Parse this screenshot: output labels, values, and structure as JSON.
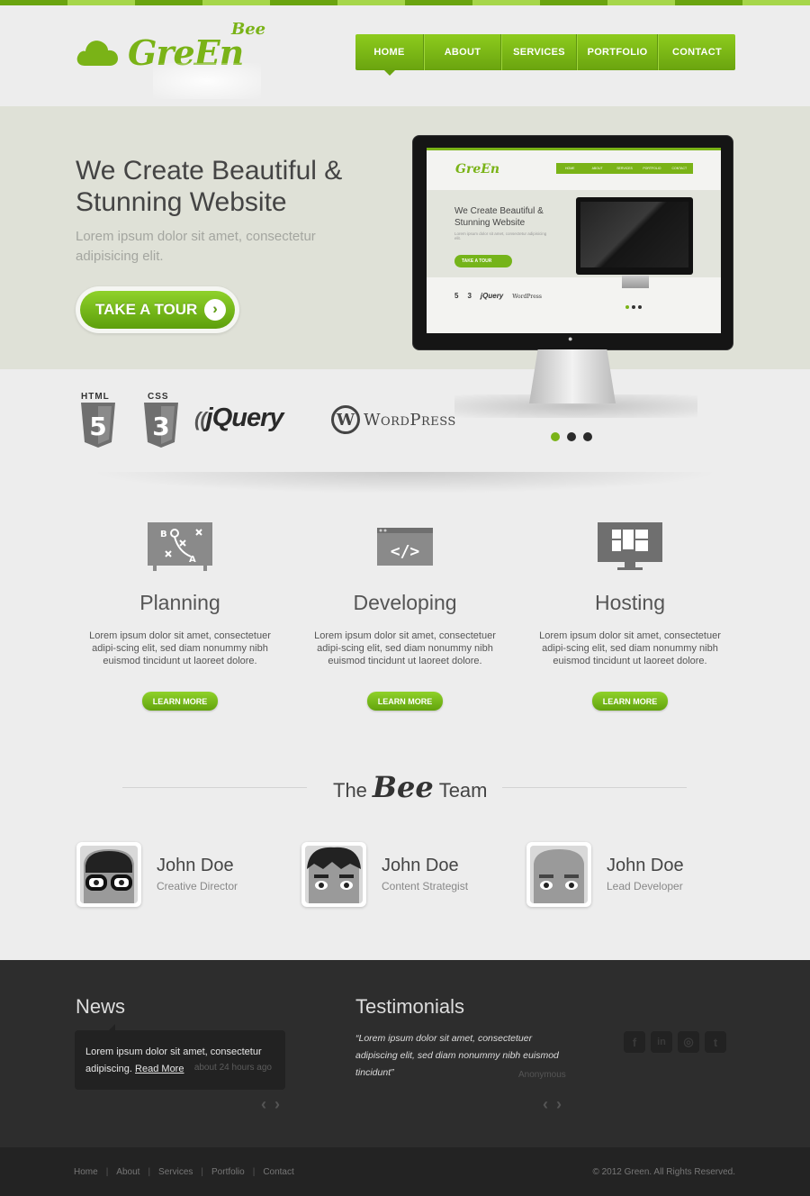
{
  "colors": {
    "accent": "#7ab317",
    "dark": "#2d2d2d"
  },
  "logo": {
    "line1": "Bee",
    "line2": "GreEn"
  },
  "nav": {
    "items": [
      "HOME",
      "ABOUT",
      "SERVICES",
      "PORTFOLIO",
      "CONTACT"
    ],
    "active": "HOME"
  },
  "hero": {
    "title": "We Create Beautiful & Stunning Website",
    "subtitle": "Lorem ipsum dolor sit amet, consectetur adipisicing elit.",
    "button": "TAKE A TOUR",
    "button_icon": "chevron-right-icon"
  },
  "preview": {
    "logo": "GreEn",
    "nav": [
      "HOME",
      "ABOUT",
      "SERVICES",
      "PORTFOLIO",
      "CONTACT"
    ],
    "title": "We Create Beautiful & Stunning Website",
    "subtitle": "Lorem ipsum dolor sit amet, consectetur adipisicing elit.",
    "button": "TAKE A TOUR",
    "logos": [
      "5",
      "3",
      "jQuery",
      "WordPress"
    ]
  },
  "tech_logos": {
    "html": "HTML",
    "html_digit": "5",
    "css": "CSS",
    "css_digit": "3",
    "jquery": "jQuery",
    "wordpress": "WordPress",
    "wp_mark": "W"
  },
  "slider": {
    "count": 3,
    "active": 1
  },
  "services": [
    {
      "name": "Planning",
      "icon": "strategy-board-icon",
      "desc": "Lorem ipsum dolor sit amet, consectetuer adipi-scing elit, sed diam nonummy nibh euismod tincidunt ut laoreet dolore.",
      "button": "LEARN MORE"
    },
    {
      "name": "Developing",
      "icon": "code-window-icon",
      "desc": "Lorem ipsum dolor sit amet, consectetuer adipi-scing elit, sed diam nonummy nibh euismod tincidunt ut laoreet dolore.",
      "button": "LEARN MORE"
    },
    {
      "name": "Hosting",
      "icon": "monitor-layout-icon",
      "desc": "Lorem ipsum dolor sit amet, consectetuer adipi-scing elit, sed diam nonummy nibh euismod tincidunt ut laoreet dolore.",
      "button": "LEARN MORE"
    }
  ],
  "team": {
    "title_pre": "The",
    "title_bee": "Bee",
    "title_post": "Team",
    "members": [
      {
        "name": "John Doe",
        "role": "Creative Director",
        "avatar": "glasses-avatar-icon"
      },
      {
        "name": "John Doe",
        "role": "Content Strategist",
        "avatar": "dark-hair-avatar-icon"
      },
      {
        "name": "John Doe",
        "role": "Lead Developer",
        "avatar": "bald-avatar-icon"
      }
    ]
  },
  "news": {
    "heading": "News",
    "text": "Lorem ipsum dolor sit amet, consectetur adipiscing.",
    "link": "Read More",
    "time": "about 24 hours ago",
    "arrows": "‹ ›"
  },
  "testimonials": {
    "heading": "Testimonials",
    "quote": "“Lorem ipsum dolor sit amet, consectetuer adipiscing elit, sed diam nonummy nibh euismod tincidunt”",
    "author": "Anonymous",
    "arrows": "‹ ›"
  },
  "social": [
    {
      "icon": "facebook-icon",
      "glyph": "f"
    },
    {
      "icon": "linkedin-icon",
      "glyph": "in"
    },
    {
      "icon": "dribbble-icon",
      "glyph": "◎"
    },
    {
      "icon": "twitter-icon",
      "glyph": "t"
    }
  ],
  "footer": {
    "links": [
      "Home",
      "About",
      "Services",
      "Portfolio",
      "Contact"
    ],
    "separator": "|",
    "copyright": "© 2012 Green. All Rights Reserved."
  }
}
